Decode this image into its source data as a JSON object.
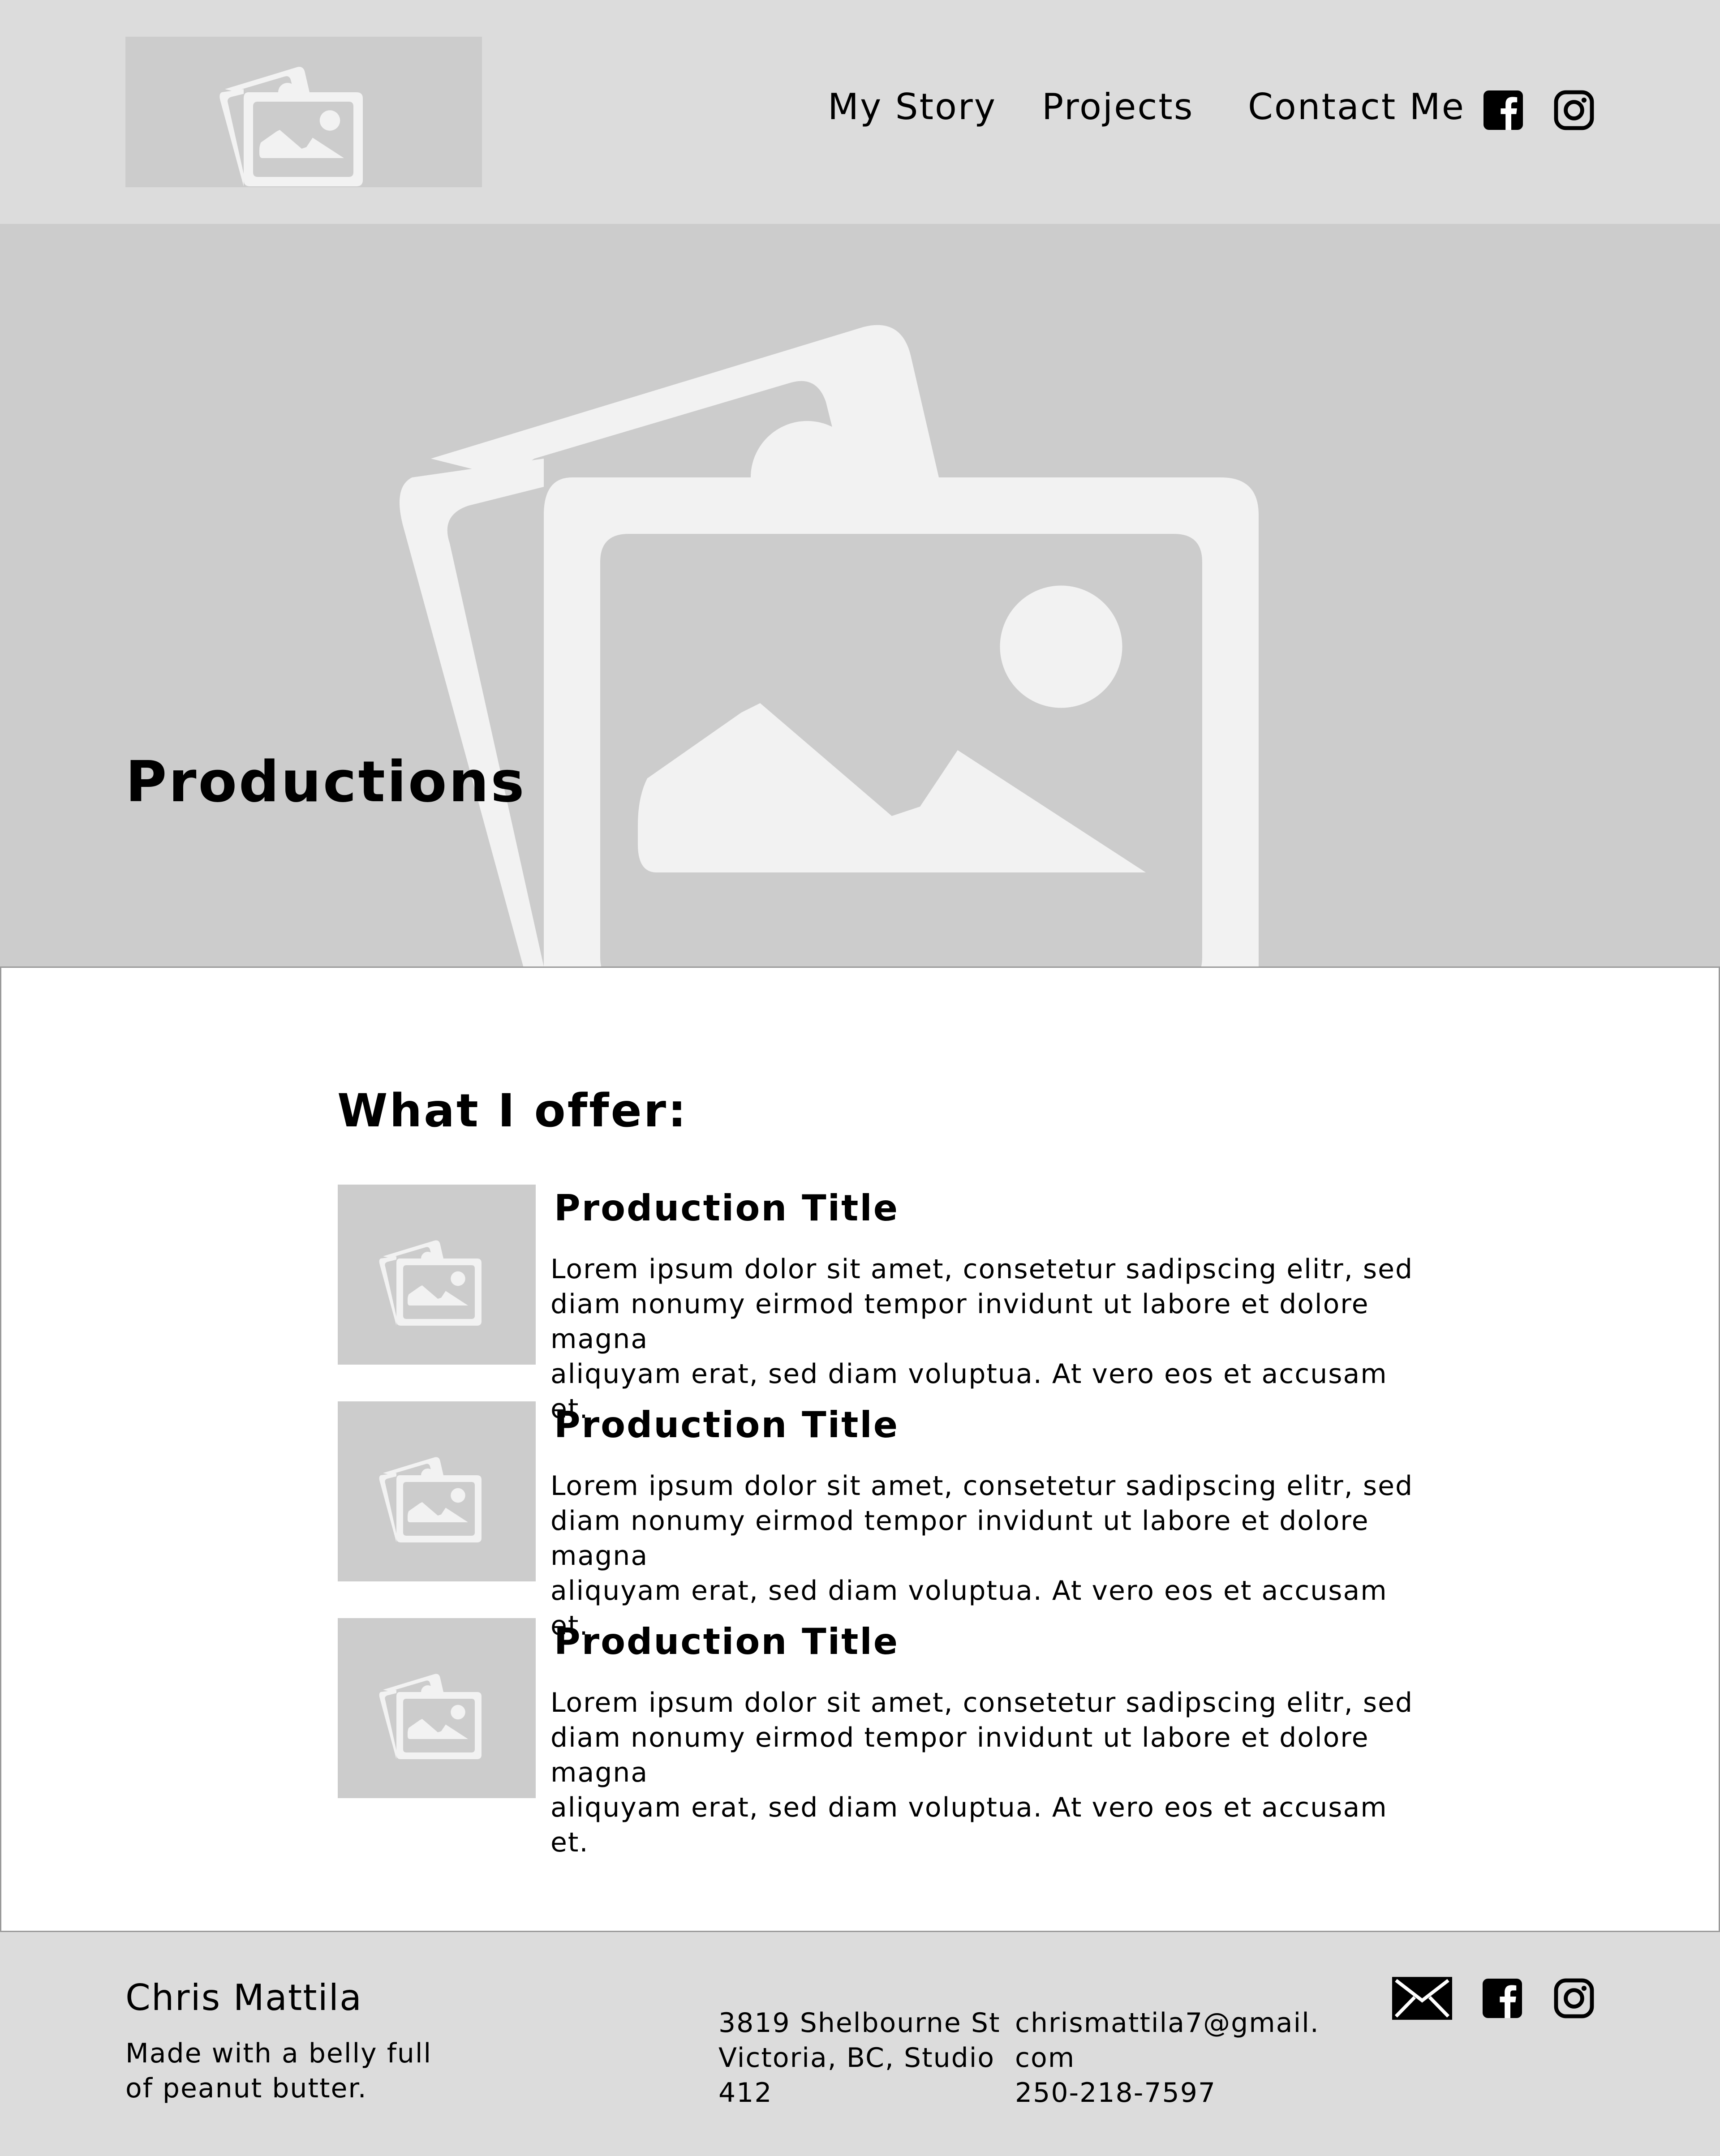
{
  "header": {
    "logo_icon": "image-placeholder-icon",
    "nav": [
      {
        "label": "My Story"
      },
      {
        "label": "Projects"
      },
      {
        "label": "Contact Me"
      }
    ],
    "social_icons": [
      "facebook-icon",
      "instagram-icon"
    ]
  },
  "hero": {
    "title": "Productions",
    "background_icon": "image-placeholder-icon"
  },
  "main": {
    "heading": "What I offer:",
    "items": [
      {
        "title": "Production Title",
        "lines": [
          "Lorem ipsum dolor sit amet, consetetur sadipscing elitr, sed",
          "diam nonumy eirmod tempor invidunt ut labore et dolore magna",
          "aliquyam erat, sed diam voluptua. At vero eos et accusam et."
        ]
      },
      {
        "title": "Production Title",
        "lines": [
          "Lorem ipsum dolor sit amet, consetetur sadipscing elitr, sed",
          "diam nonumy eirmod tempor invidunt ut labore et dolore magna",
          "aliquyam erat, sed diam voluptua. At vero eos et accusam et."
        ]
      },
      {
        "title": "Production Title",
        "lines": [
          "Lorem ipsum dolor sit amet, consetetur sadipscing elitr, sed",
          "diam nonumy eirmod tempor invidunt ut labore et dolore magna",
          "aliquyam erat, sed diam voluptua. At vero eos et accusam et."
        ]
      }
    ]
  },
  "footer": {
    "name": "Chris Mattila",
    "tagline_lines": [
      "Made with a belly full",
      "of peanut butter."
    ],
    "address_lines": [
      "3819 Shelbourne St",
      "Victoria, BC, Studio",
      "412"
    ],
    "contact_lines": [
      "chrismattila7@gmail.",
      "com",
      "250-218-7597"
    ],
    "social_icons": [
      "mail-icon",
      "facebook-icon",
      "instagram-icon"
    ]
  },
  "colors": {
    "header_bg": "#dcdcdc",
    "placeholder_bg": "#cccccc",
    "placeholder_fg": "#f2f2f2",
    "main_bg": "#ffffff",
    "text": "#000000"
  }
}
